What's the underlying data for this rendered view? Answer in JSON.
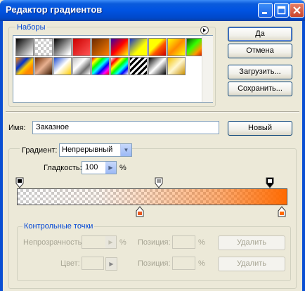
{
  "window": {
    "title": "Редактор градиентов"
  },
  "presets": {
    "label": "Наборы",
    "swatches_row1": [
      "linear-gradient(135deg,#000,#fff)",
      "checker",
      "linear-gradient(135deg,#000,#fff 90%)",
      "linear-gradient(135deg,#c00,#f55)",
      "linear-gradient(135deg,#6b2a00,#ff7f00)",
      "linear-gradient(135deg,#3600a8,#f00 50%,#ff0)",
      "linear-gradient(135deg,#1432c8,#ff0 60%)",
      "linear-gradient(135deg,#ff0,#ff0 40%,#f50 60%,#c00)",
      "linear-gradient(135deg,#ff0,#f80 50%,#ff0)",
      "linear-gradient(135deg,#0a5a0a,#3f0 40%,#f90 70%,#c00)"
    ],
    "swatches_row2": [
      "linear-gradient(135deg,#f80,#03c 35%,#fc0 55%,#f80 75%)",
      "linear-gradient(135deg,#6b2a00,#e8b090 50%,#3a1800)",
      "linear-gradient(135deg,#1c4bd0,#fff 50%,#fc0)",
      "linear-gradient(135deg,#c0c0c0,#fff 40%,#707070 70%,#fff)",
      "linear-gradient(135deg,#f00,#ff0 18%,#0f0 34%,#0ff 50%,#00f 66%,#f0f 82%,#f00)",
      "linear-gradient(135deg,#fff 0%,#f00 20%,#ff0 35%,#0f0 50%,#0ff 65%,#00f 80%,#fff)",
      "repeating-linear-gradient(135deg,#000 0 3px,#fff 3px 6px)",
      "linear-gradient(135deg,#000,#fff 50%,#000)",
      "linear-gradient(135deg,#f2c200,#fff7d0 50%,#c98f00)"
    ]
  },
  "buttons": {
    "ok": "Да",
    "cancel": "Отмена",
    "load": "Загрузить...",
    "save": "Сохранить...",
    "new": "Новый",
    "delete": "Удалить"
  },
  "name_field": {
    "label": "Имя:",
    "value": "Заказное"
  },
  "gradient_type": {
    "label": "Градиент:",
    "value": "Непрерывный"
  },
  "smoothness": {
    "label": "Гладкость:",
    "value": "100",
    "unit": "%"
  },
  "gradient": {
    "start_color": "#ff6a00",
    "end_color": "#ff6a00",
    "opacity_stops_percent": [
      0,
      52,
      100
    ],
    "color_stops_percent": [
      45,
      100
    ],
    "color_stop_color": "#e8581e"
  },
  "control_points": {
    "label": "Контрольные точки",
    "opacity_label": "Непрозрачность:",
    "opacity_unit": "%",
    "position_label": "Позиция:",
    "position_unit": "%",
    "color_label": "Цвет:"
  }
}
